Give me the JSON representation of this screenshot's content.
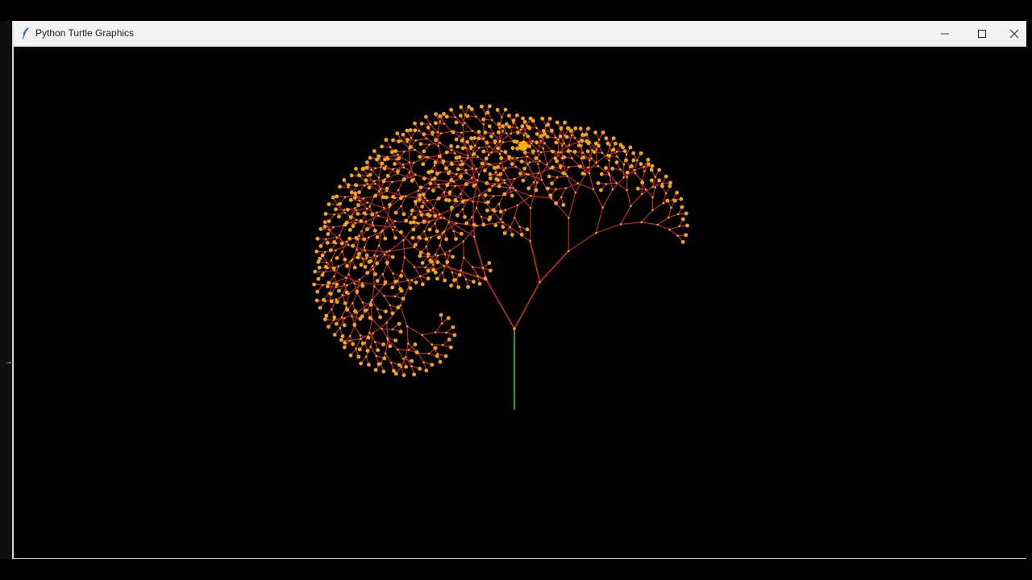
{
  "window": {
    "title": "Python Turtle Graphics",
    "controls": {
      "minimize": "minimize",
      "maximize": "maximize",
      "close": "close"
    }
  },
  "canvas": {
    "background": "#000000",
    "trunk_color": "#2e9e2e",
    "branch_color": "#b8292f",
    "leaf_color": "#f2a51c",
    "turtle_color": "#ffb000"
  },
  "icons": {
    "app": "feather-icon",
    "minimize": "minimize-icon",
    "maximize": "maximize-icon",
    "close": "close-icon",
    "cursor": "resize-cursor-icon"
  }
}
